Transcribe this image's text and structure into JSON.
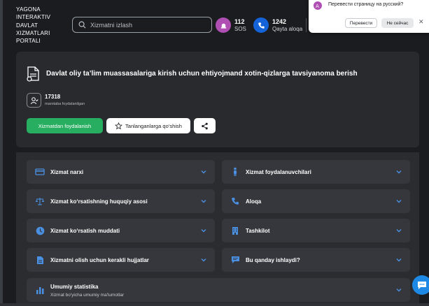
{
  "header": {
    "logo_lines": [
      "YAGONA",
      "INTERAKTIV",
      "DAVLAT",
      "XIZMATLARI",
      "PORTALI"
    ],
    "search_placeholder": "Xizmatni izlash",
    "sos": {
      "count": "112",
      "label": "SOS"
    },
    "callback": {
      "count": "1242",
      "label": "Qayta aloqa"
    }
  },
  "translate_popup": {
    "title": "Перевести страницу на русский?",
    "translate_label": "Перевести",
    "not_now_label": "Не сейчас",
    "close_label": "✕"
  },
  "service": {
    "title": "Davlat oliy ta’lim muassasalariga kirish uchun ehtiyojmand xotin-qizlarga tavsiyanoma berish",
    "users_count": "17318",
    "users_label": "marotaba foydalanilgan",
    "use_button": "Xizmatdan foydalanish",
    "favorite_button": "Tanlanganlarga qo‘shish"
  },
  "sections": {
    "price": "Xizmat narxi",
    "users": "Xizmat foydalanuvchilari",
    "legal": "Xizmat ko‘rsatishning huquqiy asosi",
    "contact": "Aloqa",
    "duration": "Xizmat ko‘rsatish muddati",
    "organization": "Tashkilot",
    "documents": "Xizmatni olish uchun kerakli hujjatlar",
    "how": "Bu qanday ishlaydi?",
    "stats_title": "Umumiy statistika",
    "stats_subtitle": "Xizmat bo'yicha umumiy ma'lumotlar"
  },
  "colors": {
    "accent_blue": "#1e88e5",
    "green": "#27ae60",
    "sos": "#b04fb3"
  }
}
